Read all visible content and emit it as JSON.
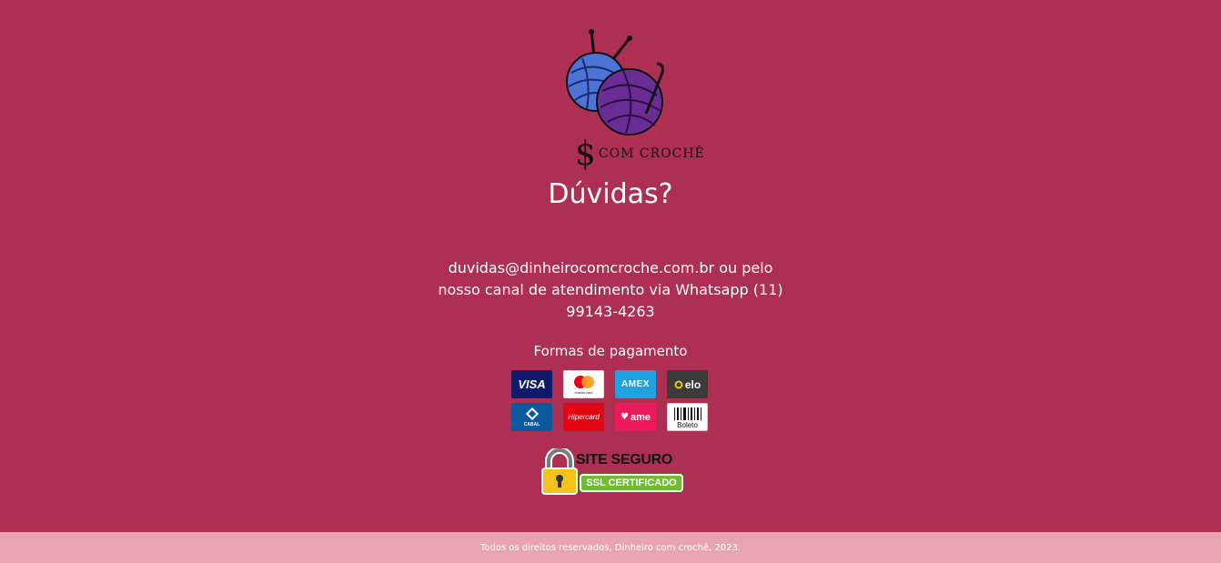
{
  "brand": {
    "logo_symbol": "$",
    "logo_text": "COM CROCHÊ"
  },
  "main": {
    "title": "Dúvidas?",
    "contact_text": "duvidas@dinheirocomcroche.com.br ou pelo nosso canal de atendimento via Whatsapp (11) 99143-4263"
  },
  "payment": {
    "title": "Formas de pagamento",
    "methods": [
      {
        "name": "visa",
        "label": "VISA",
        "color": "#0f1a6a"
      },
      {
        "name": "mastercard",
        "label": "mastercard",
        "color": "#ffffff"
      },
      {
        "name": "amex",
        "label": "AMEX",
        "color": "#1fa3e0"
      },
      {
        "name": "elo",
        "label": "elo",
        "color": "#3b3b3b"
      },
      {
        "name": "cabal",
        "label": "CABAL",
        "color": "#0c5a9e"
      },
      {
        "name": "hipercard",
        "label": "Hipercard",
        "color": "#e20613"
      },
      {
        "name": "ame",
        "label": "ame",
        "color": "#ed1b5a"
      },
      {
        "name": "boleto",
        "label": "Boleto",
        "color": "#ffffff"
      }
    ]
  },
  "security_seal": {
    "top_text": "SITE SEGURO",
    "bottom_text": "SSL CERTIFICADO",
    "icon": "padlock-icon"
  },
  "footer": {
    "copyright": "Todos os direitos reservados, Dinheiro com crochê, 2023."
  },
  "colors": {
    "background": "#ad2f51",
    "footer_background": "#e8a5b0"
  }
}
